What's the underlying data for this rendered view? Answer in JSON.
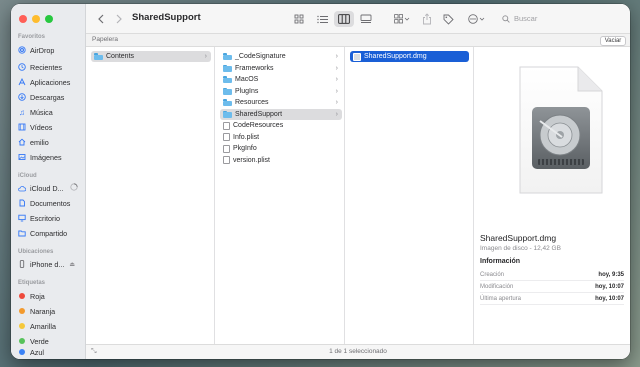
{
  "window": {
    "title": "SharedSupport"
  },
  "sidebar": {
    "sections": [
      {
        "label": "Favoritos",
        "items": [
          {
            "label": "AirDrop",
            "icon": "airdrop-icon"
          },
          {
            "label": "Recientes",
            "icon": "clock-icon"
          },
          {
            "label": "Aplicaciones",
            "icon": "apps-icon"
          },
          {
            "label": "Descargas",
            "icon": "download-icon"
          },
          {
            "label": "Música",
            "icon": "music-icon"
          },
          {
            "label": "Vídeos",
            "icon": "film-icon"
          },
          {
            "label": "emilio",
            "icon": "home-icon"
          },
          {
            "label": "Imágenes",
            "icon": "photo-icon"
          }
        ]
      },
      {
        "label": "iCloud",
        "items": [
          {
            "label": "iCloud D...",
            "icon": "cloud-icon"
          },
          {
            "label": "Documentos",
            "icon": "document-icon"
          },
          {
            "label": "Escritorio",
            "icon": "desktop-icon"
          },
          {
            "label": "Compartido",
            "icon": "shared-folder-icon"
          }
        ]
      },
      {
        "label": "Ubicaciones",
        "items": [
          {
            "label": "iPhone d...",
            "icon": "iphone-icon"
          }
        ]
      },
      {
        "label": "Etiquetas",
        "items": [
          {
            "label": "Roja",
            "color": "#ee4a3c"
          },
          {
            "label": "Naranja",
            "color": "#f39a2d"
          },
          {
            "label": "Amarilla",
            "color": "#f5c83a"
          },
          {
            "label": "Verde",
            "color": "#56c25a"
          },
          {
            "label": "Azul",
            "color": "#3a82f6"
          }
        ]
      }
    ]
  },
  "toolbar": {
    "search_placeholder": "Buscar"
  },
  "pathbar": {
    "label": "Papelera",
    "empty_button": "Vaciar"
  },
  "columns": [
    {
      "items": [
        {
          "label": "Contents",
          "type": "folder",
          "selected": "gray",
          "has_children": true
        }
      ]
    },
    {
      "items": [
        {
          "label": "_CodeSignature",
          "type": "folder",
          "has_children": true
        },
        {
          "label": "Frameworks",
          "type": "folder",
          "has_children": true
        },
        {
          "label": "MacOS",
          "type": "folder",
          "has_children": true
        },
        {
          "label": "PlugIns",
          "type": "folder",
          "has_children": true
        },
        {
          "label": "Resources",
          "type": "folder",
          "has_children": true
        },
        {
          "label": "SharedSupport",
          "type": "folder",
          "selected": "gray",
          "has_children": true
        },
        {
          "label": "CodeResources",
          "type": "file"
        },
        {
          "label": "Info.plist",
          "type": "file"
        },
        {
          "label": "PkgInfo",
          "type": "file"
        },
        {
          "label": "version.plist",
          "type": "file"
        }
      ]
    },
    {
      "items": [
        {
          "label": "SharedSupport.dmg",
          "type": "dmg",
          "selected": "blue"
        }
      ]
    }
  ],
  "preview": {
    "filename": "SharedSupport.dmg",
    "kind": "Imagen de disco - 12,42 GB",
    "info_heading": "Información",
    "rows": [
      {
        "key": "Creación",
        "value": "hoy, 9:35"
      },
      {
        "key": "Modificación",
        "value": "hoy, 10:07"
      },
      {
        "key": "Última apertura",
        "value": "hoy, 10:07"
      }
    ]
  },
  "statusbar": {
    "text": "1 de 1 seleccionado"
  },
  "colors": {
    "accent": "#1a5fd6",
    "traffic_red": "#ff5f57",
    "traffic_yellow": "#febc2e",
    "traffic_green": "#28c840"
  }
}
